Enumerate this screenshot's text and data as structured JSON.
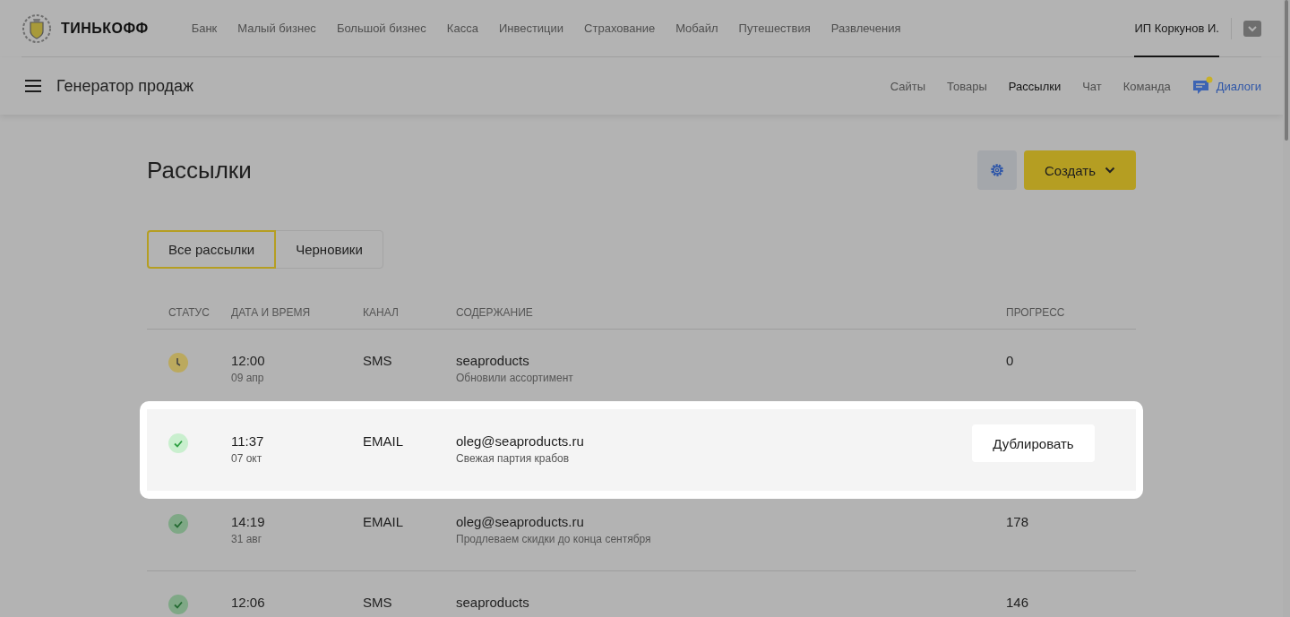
{
  "header": {
    "logo": "ТИНЬКОФФ",
    "nav": [
      {
        "label": "Банк",
        "selected": false
      },
      {
        "label": "Малый бизнес",
        "selected": false
      },
      {
        "label": "Большой бизнес",
        "selected": false
      },
      {
        "label": "Касса",
        "selected": false
      },
      {
        "label": "Инвестиции",
        "selected": false
      },
      {
        "label": "Страхование",
        "selected": false
      },
      {
        "label": "Мобайл",
        "selected": false
      },
      {
        "label": "Путешествия",
        "selected": false
      },
      {
        "label": "Развлечения",
        "selected": false
      }
    ],
    "user": {
      "label": "ИП Коркунов И.",
      "selected": true
    }
  },
  "subheader": {
    "title": "Генератор продаж",
    "nav": [
      {
        "label": "Сайты",
        "kind": "link",
        "selected": false
      },
      {
        "label": "Товары",
        "kind": "link",
        "selected": false
      },
      {
        "label": "Рассылки",
        "kind": "link",
        "selected": true
      },
      {
        "label": "Чат",
        "kind": "link",
        "selected": false
      },
      {
        "label": "Команда",
        "kind": "link",
        "selected": false
      },
      {
        "label": "Диалоги",
        "kind": "dialogs",
        "unread": true
      }
    ]
  },
  "page": {
    "title": "Рассылки",
    "create_button": "Создать"
  },
  "tabs": [
    {
      "label": "Все рассылки",
      "selected": true
    },
    {
      "label": "Черновики",
      "selected": false
    }
  ],
  "table": {
    "columns": [
      "СТАТУС",
      "ДАТА И ВРЕМЯ",
      "КАНАЛ",
      "СОДЕРЖАНИЕ",
      "ПРОГРЕСС"
    ],
    "rows": [
      {
        "kind": "scheduled",
        "time": "12:00",
        "date": "09 апр",
        "channel": "SMS",
        "recipient": "seaproducts",
        "subject": "Обновили ассортимент",
        "progress": "0",
        "highlighted": false
      },
      {
        "kind": "sent",
        "time": "11:37",
        "date": "07 окт",
        "channel": "EMAIL",
        "recipient": "oleg@seaproducts.ru",
        "subject": "Свежая партия крабов",
        "action": "Дублировать",
        "highlighted": true
      },
      {
        "kind": "sent",
        "time": "14:19",
        "date": "31 авг",
        "channel": "EMAIL",
        "recipient": "oleg@seaproducts.ru",
        "subject": "Продлеваем скидки до конца сентября",
        "progress": "178",
        "highlighted": false
      },
      {
        "kind": "sent",
        "time": "12:06",
        "channel": "SMS",
        "recipient": "seaproducts",
        "progress": "146",
        "highlighted": false
      }
    ]
  }
}
